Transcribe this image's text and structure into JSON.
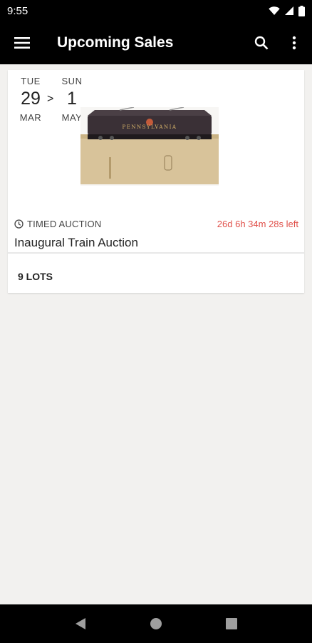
{
  "status_bar": {
    "time": "9:55"
  },
  "app_bar": {
    "title": "Upcoming Sales"
  },
  "sale": {
    "start": {
      "dow": "TUE",
      "day": "29",
      "month": "MAR"
    },
    "arrow": ">",
    "end": {
      "dow": "SUN",
      "day": "1",
      "month": "MAY"
    },
    "image_text": "PENNSYLVANIA",
    "type": "TIMED AUCTION",
    "countdown": "26d 6h 34m 28s left",
    "title": "Inaugural Train Auction",
    "lots": "9 LOTS"
  },
  "colors": {
    "bar": "#000000",
    "background": "#f2f1ef",
    "countdown": "#e0504a"
  },
  "icons": [
    "wifi-icon",
    "signal-icon",
    "battery-icon",
    "menu-icon",
    "search-icon",
    "more-vert-icon",
    "clock-icon",
    "back-icon",
    "home-icon",
    "recents-icon"
  ]
}
